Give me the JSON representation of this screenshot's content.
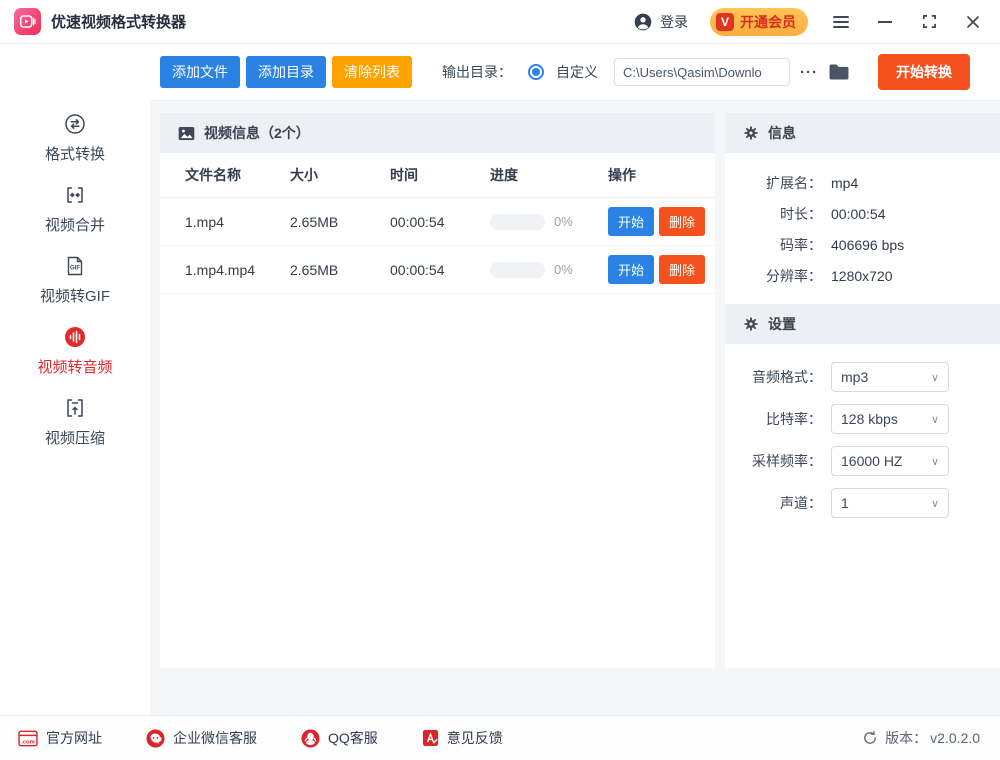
{
  "titlebar": {
    "app_title": "优速视频格式转换器",
    "login_label": "登录",
    "vip_badge": "V",
    "vip_label": "开通会员"
  },
  "toolbar": {
    "add_file": "添加文件",
    "add_dir": "添加目录",
    "clear_list": "清除列表",
    "output_dir_label": "输出目录：",
    "custom_label": "自定义",
    "path_value": "C:\\Users\\Qasim\\Downlo",
    "more_label": "···",
    "start_convert": "开始转换"
  },
  "sidebar": {
    "active_index": 3,
    "items": [
      {
        "label": "格式转换"
      },
      {
        "label": "视频合并"
      },
      {
        "label": "视频转GIF",
        "icon_text": "GIF"
      },
      {
        "label": "视频转音频"
      },
      {
        "label": "视频压缩"
      }
    ]
  },
  "table": {
    "title": "视频信息（2个）",
    "headers": [
      "文件名称",
      "大小",
      "时间",
      "进度",
      "操作"
    ],
    "rows": [
      {
        "name": "1.mp4",
        "size": "2.65MB",
        "time": "00:00:54",
        "progress": "0%",
        "start": "开始",
        "delete": "删除"
      },
      {
        "name": "1.mp4.mp4",
        "size": "2.65MB",
        "time": "00:00:54",
        "progress": "0%",
        "start": "开始",
        "delete": "删除"
      }
    ]
  },
  "info_panel": {
    "title": "信息",
    "rows": [
      {
        "label": "扩展名：",
        "value": "mp4"
      },
      {
        "label": "时长：",
        "value": "00:00:54"
      },
      {
        "label": "码率：",
        "value": "406696 bps"
      },
      {
        "label": "分辨率：",
        "value": "1280x720"
      }
    ]
  },
  "settings_panel": {
    "title": "设置",
    "rows": [
      {
        "label": "音频格式：",
        "value": "mp3"
      },
      {
        "label": "比特率：",
        "value": "128 kbps"
      },
      {
        "label": "采样频率：",
        "value": "16000 HZ"
      },
      {
        "label": "声道：",
        "value": "1"
      }
    ]
  },
  "footer": {
    "links": [
      {
        "label": "官方网址",
        "icon": "website-icon"
      },
      {
        "label": "企业微信客服",
        "icon": "wechat-service-icon"
      },
      {
        "label": "QQ客服",
        "icon": "qq-icon"
      },
      {
        "label": "意见反馈",
        "icon": "feedback-icon"
      }
    ],
    "version_label": "版本：",
    "version_value": "v2.0.2.0"
  },
  "colors": {
    "accent_blue": "#2a82e4",
    "accent_orange": "#ffa200",
    "accent_red": "#f4511e",
    "brand_pink": "#ee2e56",
    "active_red": "#e0282d",
    "footer_icon_red": "#d9252b"
  }
}
